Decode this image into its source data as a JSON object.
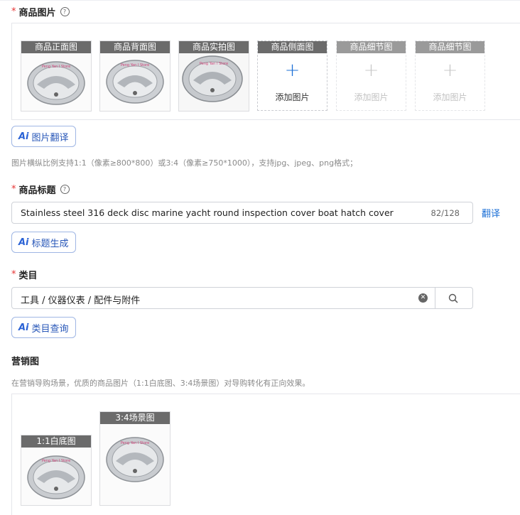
{
  "product_images": {
    "label": "商品图片",
    "slots": [
      {
        "caption": "商品正面图",
        "filled": true
      },
      {
        "caption": "商品背面图",
        "filled": true
      },
      {
        "caption": "商品实拍图",
        "filled": true
      },
      {
        "caption": "商品侧面图",
        "filled": false,
        "add_label": "添加图片"
      },
      {
        "caption": "商品细节图",
        "filled": false,
        "add_label": "添加图片"
      },
      {
        "caption": "商品细节图",
        "filled": false,
        "add_label": "添加图片"
      }
    ],
    "translate_button": "图片翻译",
    "hint": "图片横纵比例支持1:1（像素≥800*800）或3:4（像素≥750*1000），支持jpg、jpeg、png格式；"
  },
  "product_title": {
    "label": "商品标题",
    "value": "Stainless steel 316 deck disc marine yacht round inspection cover boat hatch cover",
    "counter": "82/128",
    "translate_link": "翻译",
    "generate_button": "标题生成"
  },
  "category": {
    "label": "类目",
    "value": "工具 / 仪器仪表 / 配件与附件",
    "query_button": "类目查询"
  },
  "marketing": {
    "label": "营销图",
    "hint": "在营销导购场景，优质的商品图片（1:1白底图、3:4场景图）对导购转化有正向效果。",
    "images": [
      {
        "caption": "1:1白底图"
      },
      {
        "caption": "3:4场景图"
      }
    ]
  },
  "watermark_text": "Peng Yan I Store",
  "colors": {
    "accent": "#1b6fd6",
    "required": "#e63333",
    "caption_bg": "#6b6b6b"
  }
}
